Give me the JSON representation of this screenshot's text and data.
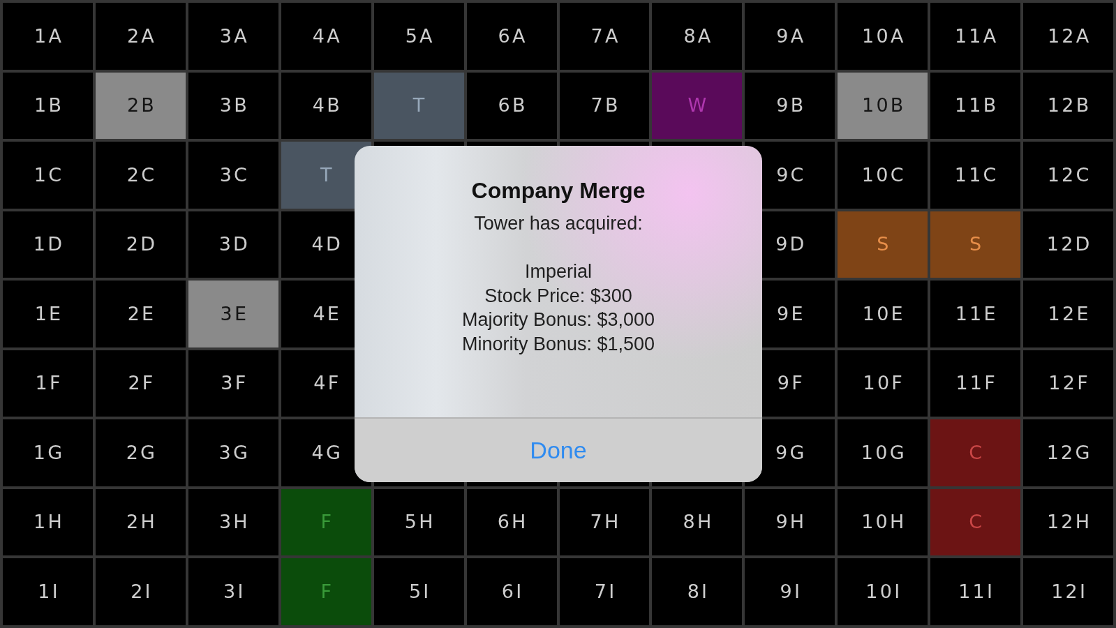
{
  "board": {
    "rows": [
      {
        "cells": [
          {
            "label": "1A",
            "kind": "open"
          },
          {
            "label": "2A",
            "kind": "open"
          },
          {
            "label": "3A",
            "kind": "open"
          },
          {
            "label": "4A",
            "kind": "open"
          },
          {
            "label": "5A",
            "kind": "open"
          },
          {
            "label": "6A",
            "kind": "open"
          },
          {
            "label": "7A",
            "kind": "open"
          },
          {
            "label": "8A",
            "kind": "open"
          },
          {
            "label": "9A",
            "kind": "open"
          },
          {
            "label": "10A",
            "kind": "open"
          },
          {
            "label": "11A",
            "kind": "open"
          },
          {
            "label": "12A",
            "kind": "open"
          }
        ]
      },
      {
        "cells": [
          {
            "label": "1B",
            "kind": "open"
          },
          {
            "label": "2B",
            "kind": "placed"
          },
          {
            "label": "3B",
            "kind": "open"
          },
          {
            "label": "4B",
            "kind": "open"
          },
          {
            "label": "T",
            "kind": "company",
            "color": "#4a5561"
          },
          {
            "label": "6B",
            "kind": "open"
          },
          {
            "label": "7B",
            "kind": "open"
          },
          {
            "label": "W",
            "kind": "company",
            "color": "#5a0a5a"
          },
          {
            "label": "9B",
            "kind": "open"
          },
          {
            "label": "10B",
            "kind": "placed"
          },
          {
            "label": "11B",
            "kind": "open"
          },
          {
            "label": "12B",
            "kind": "open"
          }
        ]
      },
      {
        "cells": [
          {
            "label": "1C",
            "kind": "open"
          },
          {
            "label": "2C",
            "kind": "open"
          },
          {
            "label": "3C",
            "kind": "open"
          },
          {
            "label": "T",
            "kind": "company",
            "color": "#4a5561"
          },
          {
            "kind": "covered"
          },
          {
            "kind": "covered"
          },
          {
            "kind": "covered"
          },
          {
            "kind": "covered"
          },
          {
            "label": "9C",
            "kind": "open"
          },
          {
            "label": "10C",
            "kind": "open"
          },
          {
            "label": "11C",
            "kind": "open"
          },
          {
            "label": "12C",
            "kind": "open"
          }
        ]
      },
      {
        "cells": [
          {
            "label": "1D",
            "kind": "open"
          },
          {
            "label": "2D",
            "kind": "open"
          },
          {
            "label": "3D",
            "kind": "open"
          },
          {
            "label": "4D",
            "kind": "open"
          },
          {
            "kind": "covered"
          },
          {
            "kind": "covered"
          },
          {
            "kind": "covered"
          },
          {
            "kind": "covered"
          },
          {
            "label": "9D",
            "kind": "open"
          },
          {
            "label": "S",
            "kind": "company",
            "color": "#7f4416"
          },
          {
            "label": "S",
            "kind": "company",
            "color": "#7f4416"
          },
          {
            "label": "12D",
            "kind": "open"
          }
        ]
      },
      {
        "cells": [
          {
            "label": "1E",
            "kind": "open"
          },
          {
            "label": "2E",
            "kind": "open"
          },
          {
            "label": "3E",
            "kind": "placed"
          },
          {
            "label": "4E",
            "kind": "open"
          },
          {
            "kind": "covered"
          },
          {
            "kind": "covered"
          },
          {
            "kind": "covered"
          },
          {
            "kind": "covered"
          },
          {
            "label": "9E",
            "kind": "open"
          },
          {
            "label": "10E",
            "kind": "open"
          },
          {
            "label": "11E",
            "kind": "open"
          },
          {
            "label": "12E",
            "kind": "open"
          }
        ]
      },
      {
        "cells": [
          {
            "label": "1F",
            "kind": "open"
          },
          {
            "label": "2F",
            "kind": "open"
          },
          {
            "label": "3F",
            "kind": "open"
          },
          {
            "label": "4F",
            "kind": "open"
          },
          {
            "kind": "covered"
          },
          {
            "kind": "covered"
          },
          {
            "kind": "covered"
          },
          {
            "kind": "covered"
          },
          {
            "label": "9F",
            "kind": "open"
          },
          {
            "label": "10F",
            "kind": "open"
          },
          {
            "label": "11F",
            "kind": "open"
          },
          {
            "label": "12F",
            "kind": "open"
          }
        ]
      },
      {
        "cells": [
          {
            "label": "1G",
            "kind": "open"
          },
          {
            "label": "2G",
            "kind": "open"
          },
          {
            "label": "3G",
            "kind": "open"
          },
          {
            "label": "4G",
            "kind": "open"
          },
          {
            "kind": "covered"
          },
          {
            "kind": "covered"
          },
          {
            "kind": "covered"
          },
          {
            "kind": "covered"
          },
          {
            "label": "9G",
            "kind": "open"
          },
          {
            "label": "10G",
            "kind": "open"
          },
          {
            "label": "C",
            "kind": "company",
            "color": "#6c1414"
          },
          {
            "label": "12G",
            "kind": "open"
          }
        ]
      },
      {
        "cells": [
          {
            "label": "1H",
            "kind": "open"
          },
          {
            "label": "2H",
            "kind": "open"
          },
          {
            "label": "3H",
            "kind": "open"
          },
          {
            "label": "F",
            "kind": "company",
            "color": "#0b4c0b"
          },
          {
            "label": "5H",
            "kind": "open"
          },
          {
            "label": "6H",
            "kind": "open"
          },
          {
            "label": "7H",
            "kind": "open"
          },
          {
            "label": "8H",
            "kind": "open"
          },
          {
            "label": "9H",
            "kind": "open"
          },
          {
            "label": "10H",
            "kind": "open"
          },
          {
            "label": "C",
            "kind": "company",
            "color": "#6c1414"
          },
          {
            "label": "12H",
            "kind": "open"
          }
        ]
      },
      {
        "cells": [
          {
            "label": "1I",
            "kind": "open"
          },
          {
            "label": "2I",
            "kind": "open"
          },
          {
            "label": "3I",
            "kind": "open"
          },
          {
            "label": "F",
            "kind": "company",
            "color": "#0b4c0b"
          },
          {
            "label": "5I",
            "kind": "open"
          },
          {
            "label": "6I",
            "kind": "open"
          },
          {
            "label": "7I",
            "kind": "open"
          },
          {
            "label": "8I",
            "kind": "open"
          },
          {
            "label": "9I",
            "kind": "open"
          },
          {
            "label": "10I",
            "kind": "open"
          },
          {
            "label": "11I",
            "kind": "open"
          },
          {
            "label": "12I",
            "kind": "open"
          }
        ]
      }
    ]
  },
  "alert": {
    "title": "Company Merge",
    "message": "Tower has acquired:\n\nImperial\nStock Price: $300\nMajority Bonus: $3,000\nMinority Bonus: $1,500",
    "button": "Done"
  }
}
